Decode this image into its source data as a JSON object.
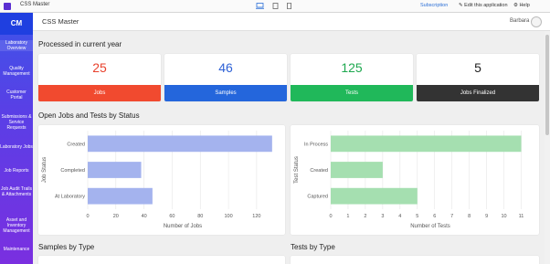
{
  "topbar": {
    "app_name": "CSS Master",
    "subscription": "Subscription",
    "edit_app": "✎ Edit this application",
    "help": "⚙ Help"
  },
  "sidebar": {
    "logo": "CM",
    "items": [
      {
        "label": "Laboratory Overview"
      },
      {
        "label": "Quality Management"
      },
      {
        "label": "Customer Portal"
      },
      {
        "label": "Submissions & Service Requests"
      },
      {
        "label": "Laboratory Jobs"
      },
      {
        "label": "Job Reports"
      },
      {
        "label": "Job Audit Trails & Attachments"
      },
      {
        "label": "Asset and Inventory Management"
      },
      {
        "label": "Maintenance"
      }
    ]
  },
  "header": {
    "title": "CSS Master",
    "user_name": "Barbara"
  },
  "sections": {
    "processed": "Processed in current year",
    "open_jobs": "Open Jobs and Tests by Status",
    "samples_by_type": "Samples by Type",
    "tests_by_type": "Tests by Type"
  },
  "kpis": [
    {
      "value": "25",
      "label": "Jobs",
      "value_color": "#e8412c",
      "bar_color": "#f14a2f"
    },
    {
      "value": "46",
      "label": "Samples",
      "value_color": "#2f62d6",
      "bar_color": "#2466dc"
    },
    {
      "value": "125",
      "label": "Tests",
      "value_color": "#1ea84f",
      "bar_color": "#20b85a"
    },
    {
      "value": "5",
      "label": "Jobs Finalized",
      "value_color": "#222222",
      "bar_color": "#333333"
    }
  ],
  "chart_data": [
    {
      "type": "bar",
      "orientation": "horizontal",
      "categories": [
        "Created",
        "Completed",
        "At Laboratory"
      ],
      "values": [
        131,
        38,
        46
      ],
      "xlabel": "Number of Jobs",
      "ylabel": "Job Status",
      "xlim": [
        0,
        135
      ],
      "xticks": [
        "0",
        "20",
        "40",
        "60",
        "80",
        "100",
        "120"
      ],
      "tick_values": [
        0,
        20,
        40,
        60,
        80,
        100,
        120
      ],
      "color": "#a4b3ee",
      "grid": true
    },
    {
      "type": "bar",
      "orientation": "horizontal",
      "categories": [
        "In Process",
        "Created",
        "Captured"
      ],
      "values": [
        11,
        3,
        5
      ],
      "xlabel": "Number of Tests",
      "ylabel": "Test Status",
      "xlim": [
        0,
        11.5
      ],
      "xticks": [
        "0",
        "1",
        "2",
        "3",
        "4",
        "5",
        "6",
        "7",
        "8",
        "9",
        "10",
        "11"
      ],
      "tick_values": [
        0,
        1,
        2,
        3,
        4,
        5,
        6,
        7,
        8,
        9,
        10,
        11
      ],
      "color": "#a5dfb0",
      "grid": true
    }
  ]
}
